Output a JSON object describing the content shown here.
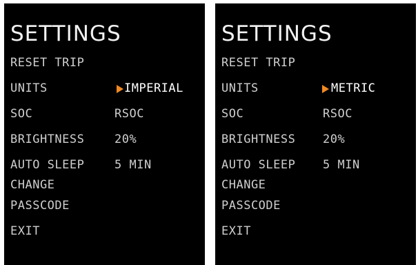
{
  "accent_color": "#f08a23",
  "screens": [
    {
      "title": "SETTINGS",
      "menu": {
        "reset_trip": "RESET TRIP",
        "units": "UNITS",
        "soc": "SOC",
        "brightness": "BRIGHTNESS",
        "auto_sleep": "AUTO SLEEP",
        "change": "CHANGE",
        "passcode": "PASSCODE",
        "exit": "EXIT"
      },
      "values": {
        "units": "IMPERIAL",
        "soc": "RSOC",
        "brightness": "20%",
        "auto_sleep": "5 MIN"
      },
      "selected_icon": "triangle-right-icon"
    },
    {
      "title": "SETTINGS",
      "menu": {
        "reset_trip": "RESET TRIP",
        "units": "UNITS",
        "soc": "SOC",
        "brightness": "BRIGHTNESS",
        "auto_sleep": "AUTO SLEEP",
        "change": "CHANGE",
        "passcode": "PASSCODE",
        "exit": "EXIT"
      },
      "values": {
        "units": "METRIC",
        "soc": "RSOC",
        "brightness": "20%",
        "auto_sleep": "5 MIN"
      },
      "selected_icon": "triangle-right-icon"
    }
  ]
}
